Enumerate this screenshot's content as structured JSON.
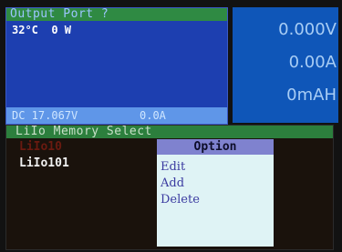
{
  "output_panel": {
    "title": "Output Port ?",
    "temperature_power": "32°C  0 W",
    "dc_voltage": "DC 17.067V",
    "dc_current": "0.0A"
  },
  "readouts": {
    "voltage": "0.000V",
    "current": "0.00A",
    "capacity": "0mAH"
  },
  "memory_select": {
    "title": "LiIo Memory Select",
    "items": [
      "LiIo10",
      "LiIo101"
    ]
  },
  "option_popup": {
    "title": "Option",
    "items": [
      "Edit",
      "Add",
      "Delete"
    ]
  }
}
